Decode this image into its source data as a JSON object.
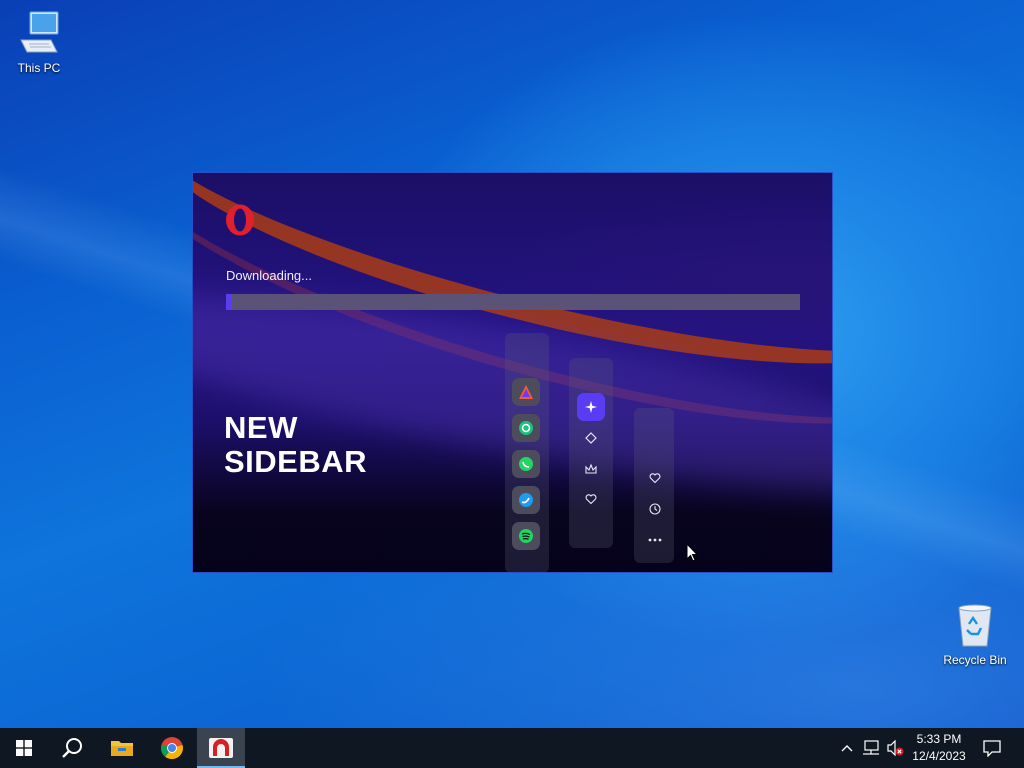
{
  "desktop": {
    "this_pc_label": "This PC",
    "recycle_bin_label": "Recycle Bin"
  },
  "installer": {
    "status_text": "Downloading...",
    "progress_fraction": 0.01,
    "headline_line1": "NEW",
    "headline_line2": "SIDEBAR",
    "sidebar_apps": [
      "aria-app-icon",
      "chatgpt-app-icon",
      "whatsapp-app-icon",
      "twitter-app-icon",
      "spotify-app-icon"
    ],
    "sidebar_tools": [
      "aria-sparkle-icon",
      "diamond-icon",
      "crown-icon",
      "heart-icon"
    ],
    "sidebar_extras": [
      "heart-icon",
      "clock-icon",
      "more-icon"
    ],
    "colors": {
      "accent": "#5b3df0",
      "opera_red": "#e0202c",
      "track": "#5a5277"
    }
  },
  "taskbar": {
    "pinned": [
      "start-icon",
      "search-icon",
      "file-explorer-icon",
      "chrome-icon",
      "opera-installer-icon"
    ],
    "time": "5:33 PM",
    "date": "12/4/2023"
  }
}
